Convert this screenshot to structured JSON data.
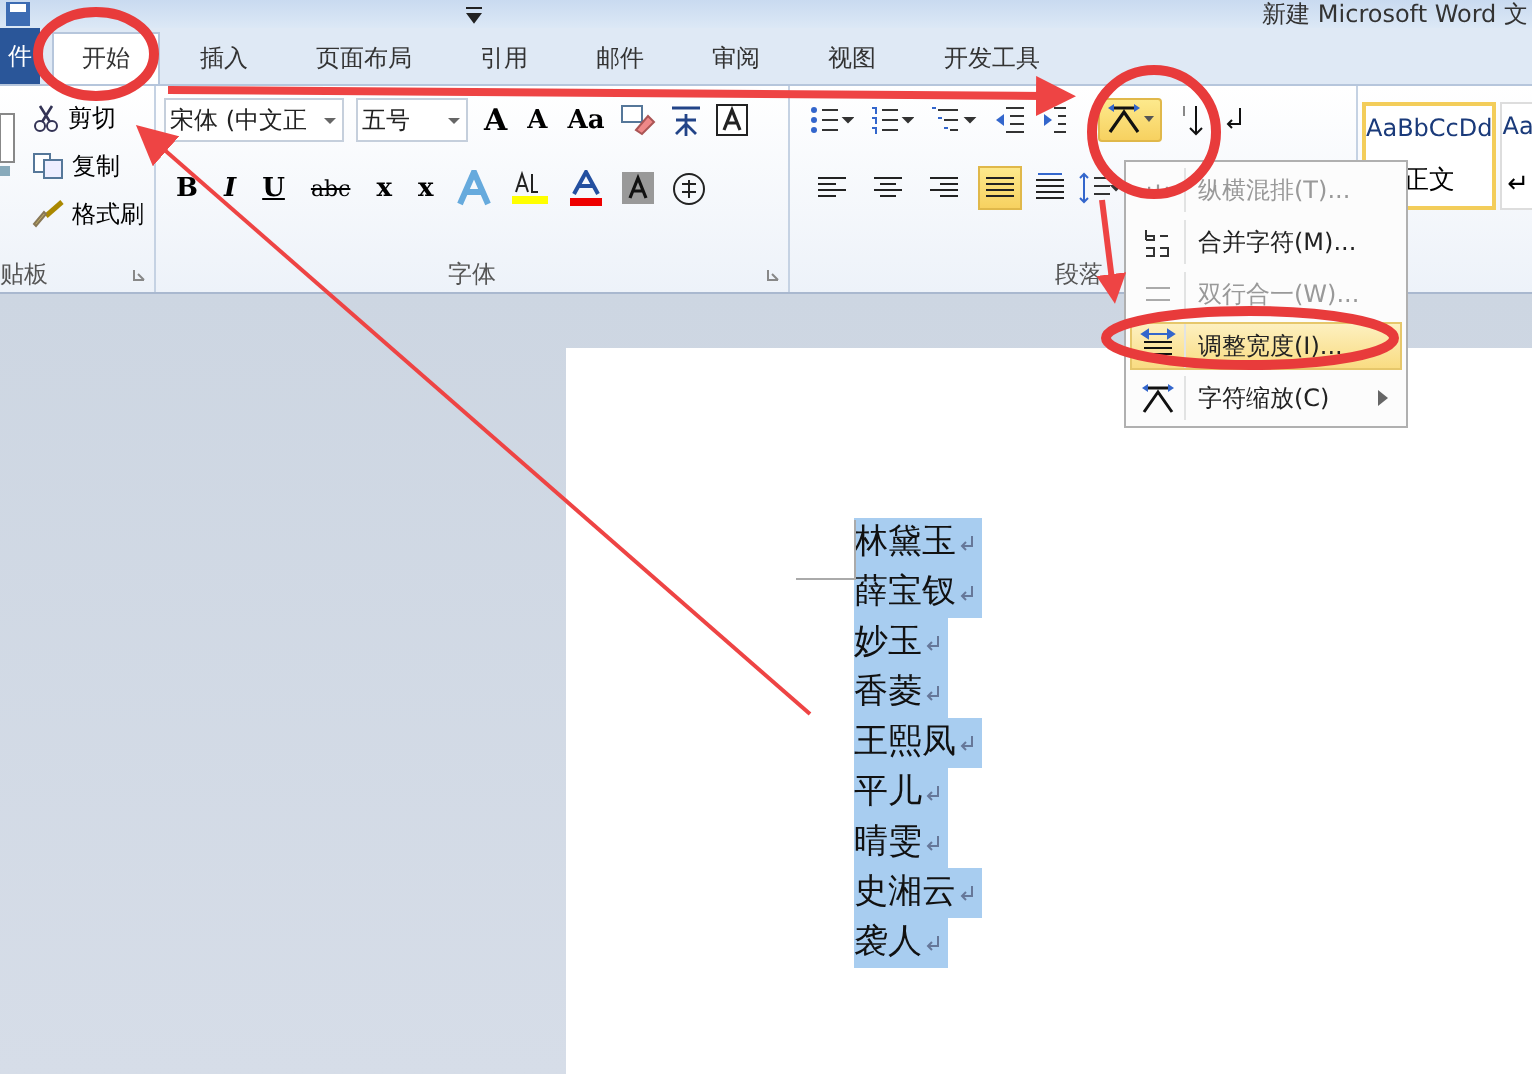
{
  "window": {
    "title": "新建 Microsoft Word 文"
  },
  "tabs": [
    {
      "label": "件",
      "kind": "file",
      "selected": false
    },
    {
      "label": "开始",
      "kind": "tab",
      "selected": true
    },
    {
      "label": "插入",
      "kind": "tab",
      "selected": false
    },
    {
      "label": "页面布局",
      "kind": "tab",
      "selected": false
    },
    {
      "label": "引用",
      "kind": "tab",
      "selected": false
    },
    {
      "label": "邮件",
      "kind": "tab",
      "selected": false
    },
    {
      "label": "审阅",
      "kind": "tab",
      "selected": false
    },
    {
      "label": "视图",
      "kind": "tab",
      "selected": false
    },
    {
      "label": "开发工具",
      "kind": "tab",
      "selected": false
    }
  ],
  "clipboard": {
    "label": "贴板",
    "items": [
      {
        "label": "剪切",
        "kind": "cut"
      },
      {
        "label": "复制",
        "kind": "copy"
      },
      {
        "label": "格式刷",
        "kind": "brush"
      }
    ]
  },
  "font": {
    "label": "字体",
    "name": "宋体 (中文正",
    "size": "五号",
    "row1": [
      "A",
      "A",
      "Aa"
    ],
    "row2": [
      "B",
      "I",
      "U",
      "abc",
      "x",
      "x"
    ]
  },
  "paragraph": {
    "label": "段落",
    "justify_selected": true
  },
  "asian_layout": {
    "selected": true
  },
  "styles": [
    {
      "sample": "AaBbCcDd",
      "name": "正文",
      "selected": true
    },
    {
      "sample": "Aa",
      "name": "↵",
      "selected": false
    }
  ],
  "menu": {
    "items": [
      {
        "label": "纵横混排(T)...",
        "kind": "vertical",
        "disabled": true,
        "selected": false,
        "submenu": false
      },
      {
        "label": "合并字符(M)...",
        "kind": "combine",
        "disabled": false,
        "selected": false,
        "submenu": false
      },
      {
        "label": "双行合一(W)...",
        "kind": "twolines",
        "disabled": true,
        "selected": false,
        "submenu": false
      },
      {
        "label": "调整宽度(I)...",
        "kind": "fit",
        "disabled": false,
        "selected": true,
        "submenu": false
      },
      {
        "label": "字符缩放(C)",
        "kind": "scale",
        "disabled": false,
        "selected": false,
        "submenu": true
      }
    ]
  },
  "document": {
    "selected": true,
    "lines": [
      "林黛玉",
      "薛宝钗",
      "妙玉",
      "香菱",
      "王熙凤",
      "平儿",
      "晴雯",
      "史湘云",
      "袭人"
    ]
  }
}
